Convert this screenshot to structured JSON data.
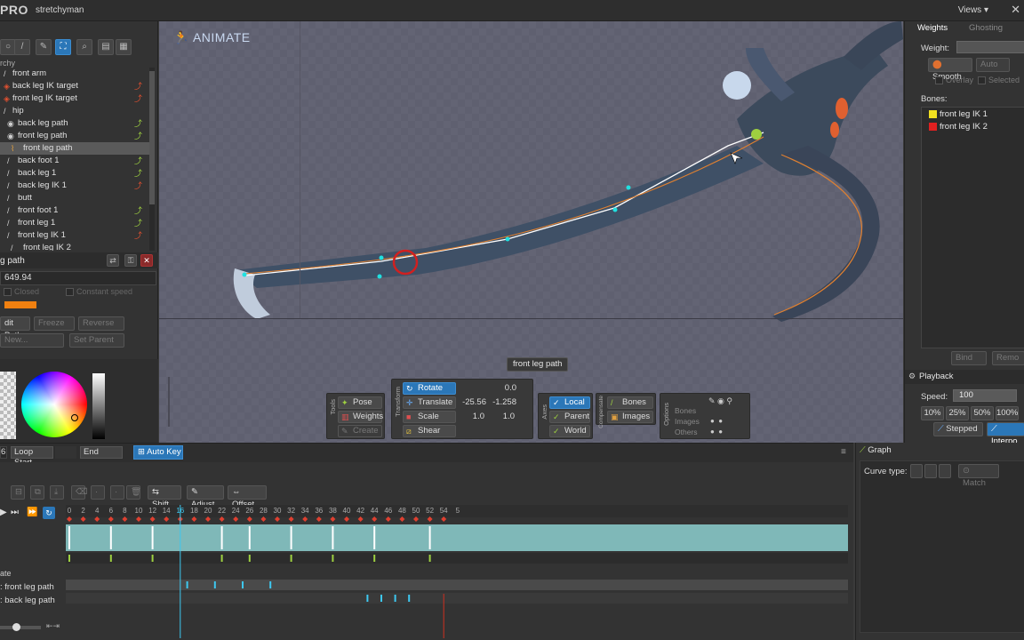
{
  "app": {
    "brand": "PRO",
    "project": "stretchyman",
    "views_label": "Views"
  },
  "hierarchy": {
    "title": "rchy",
    "rows": [
      {
        "label": "front arm",
        "icon": "bone",
        "status": "",
        "indent": 0
      },
      {
        "label": "back leg IK target",
        "icon": "target",
        "status": "off",
        "indent": 0
      },
      {
        "label": "front leg IK target",
        "icon": "target",
        "status": "off",
        "indent": 0
      },
      {
        "label": "hip",
        "icon": "bone",
        "status": "",
        "indent": 0
      },
      {
        "label": "back leg path",
        "icon": "path",
        "status": "on",
        "indent": 1
      },
      {
        "label": "front leg path",
        "icon": "path",
        "status": "on",
        "indent": 1
      },
      {
        "label": "front leg path",
        "icon": "attachment",
        "status": "",
        "indent": 2
      },
      {
        "label": "back foot 1",
        "icon": "bone",
        "status": "on",
        "indent": 1
      },
      {
        "label": "back leg 1",
        "icon": "bone",
        "status": "on",
        "indent": 1
      },
      {
        "label": "back leg IK 1",
        "icon": "bone",
        "status": "off",
        "indent": 1
      },
      {
        "label": "butt",
        "icon": "bone",
        "status": "",
        "indent": 1
      },
      {
        "label": "front foot 1",
        "icon": "bone",
        "status": "on",
        "indent": 1
      },
      {
        "label": "front leg 1",
        "icon": "bone",
        "status": "on",
        "indent": 1
      },
      {
        "label": "front leg IK 1",
        "icon": "bone",
        "status": "off",
        "indent": 1
      },
      {
        "label": "front leg IK 2",
        "icon": "bone",
        "status": "",
        "indent": 2
      }
    ],
    "selected_index": 6
  },
  "path_props": {
    "title": "g path",
    "length": "649.94",
    "closed_label": "Closed",
    "constant_speed_label": "Constant speed",
    "color": "#f08010",
    "edit_path": "dit Path",
    "freeze": "Freeze",
    "reverse": "Reverse",
    "new": "New...",
    "set_parent": "Set Parent"
  },
  "viewport": {
    "mode_label": "ANIMATE",
    "tooltip": "front leg path"
  },
  "tools": {
    "section": "Tools",
    "pose": "Pose",
    "weights": "Weights",
    "create": "Create"
  },
  "transform": {
    "section": "Transform",
    "rotate": {
      "label": "Rotate",
      "v1": "0.0"
    },
    "translate": {
      "label": "Translate",
      "v1": "-25.56",
      "v2": "-1.258"
    },
    "scale": {
      "label": "Scale",
      "v1": "1.0",
      "v2": "1.0"
    },
    "shear": {
      "label": "Shear"
    }
  },
  "axes": {
    "section": "Axes",
    "local": "Local",
    "parent": "Parent",
    "world": "World"
  },
  "compensate": {
    "section": "Compensate",
    "bones": "Bones",
    "images": "Images"
  },
  "options": {
    "section": "Options",
    "bones": "Bones",
    "images": "Images",
    "others": "Others"
  },
  "weights_panel": {
    "tab_weights": "Weights",
    "tab_ghosting": "Ghosting",
    "weight_label": "Weight:",
    "smooth": "Smooth",
    "auto": "Auto",
    "overlay": "Overlay",
    "selected": "Selected",
    "bones_label": "Bones:",
    "bones": [
      {
        "name": "front leg IK 1",
        "color": "#f0e020"
      },
      {
        "name": "front leg IK 2",
        "color": "#e02020"
      }
    ],
    "bind": "Bind",
    "remove": "Remo"
  },
  "playback": {
    "title": "Playback",
    "speed_label": "Speed:",
    "speed_value": "100",
    "presets": [
      "10%",
      "25%",
      "50%",
      "100%"
    ],
    "stepped": "Stepped",
    "interpolated": "Interpo"
  },
  "dopesheet": {
    "frame_field": "6",
    "loop_start": "Loop Start",
    "end": "End",
    "auto_key": "Auto Key",
    "shift": "Shift",
    "adjust": "Adjust",
    "offset": "Offset",
    "current_frame": "16",
    "ruler": [
      "0",
      "2",
      "4",
      "6",
      "8",
      "10",
      "12",
      "14",
      "16",
      "18",
      "20",
      "22",
      "24",
      "26",
      "28",
      "30",
      "32",
      "34",
      "36",
      "38",
      "40",
      "42",
      "44",
      "46",
      "48",
      "50",
      "52",
      "54",
      "5"
    ],
    "track_rate": "ate",
    "track_front": ": front leg path",
    "track_back": ": back leg path"
  },
  "graph": {
    "tab": "Graph",
    "curve_type": "Curve type:",
    "match": "Match"
  }
}
